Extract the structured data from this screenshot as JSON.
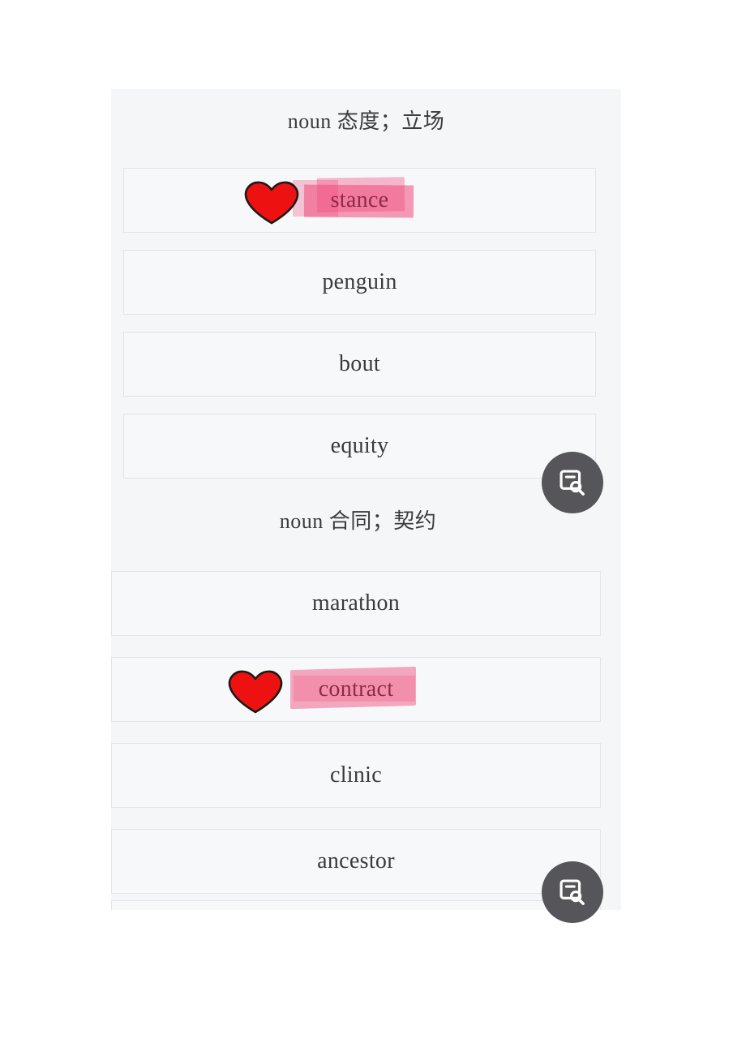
{
  "app": {
    "background_color": "#ffffff",
    "panel_background": "#f5f6f8",
    "card_background": "#f7f8fa",
    "card_border_color": "#e3e4ec",
    "text_color": "#3a3a3e",
    "marked_text_color": "#8d2c43",
    "heart_color": "#ee1111",
    "fab_color": "#56565a",
    "highlight_pink_strong": "#f0497b",
    "highlight_pink_soft": "#f59ab5"
  },
  "sections": [
    {
      "heading": "noun 态度；立场",
      "cards": [
        {
          "word": "stance",
          "marked": true,
          "heart": "red-heart-icon",
          "highlight": "strong"
        },
        {
          "word": "penguin",
          "marked": false,
          "heart": null,
          "highlight": null
        },
        {
          "word": "bout",
          "marked": false,
          "heart": null,
          "highlight": null
        },
        {
          "word": "equity",
          "marked": false,
          "heart": null,
          "highlight": null
        }
      ]
    },
    {
      "heading": "noun 合同；契约",
      "cards": [
        {
          "word": "marathon",
          "marked": false,
          "heart": null,
          "highlight": null
        },
        {
          "word": "contract",
          "marked": true,
          "heart": "red-heart-icon",
          "highlight": "soft"
        },
        {
          "word": "clinic",
          "marked": false,
          "heart": null,
          "highlight": null
        },
        {
          "word": "ancestor",
          "marked": false,
          "heart": null,
          "highlight": null
        }
      ]
    }
  ],
  "fabs": [
    {
      "name": "document-search-fab-upper",
      "icon": "document-search-icon",
      "clipped": true
    },
    {
      "name": "document-search-fab-lower",
      "icon": "document-search-icon",
      "clipped": false
    }
  ]
}
